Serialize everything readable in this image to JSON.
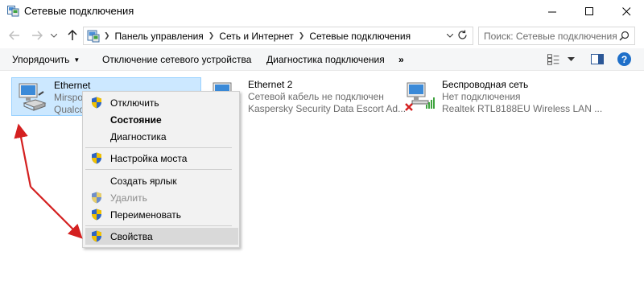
{
  "window": {
    "title": "Сетевые подключения",
    "controls": {
      "minimize": "—",
      "maximize": "☐",
      "close": "✕"
    }
  },
  "address": {
    "crumbs": [
      "Панель управления",
      "Сеть и Интернет",
      "Сетевые подключения"
    ],
    "search_placeholder": "Поиск: Сетевые подключения"
  },
  "toolbar": {
    "organize": "Упорядочить",
    "disable": "Отключение сетевого устройства",
    "diagnose": "Диагностика подключения",
    "more": "»",
    "help": "?"
  },
  "connections": [
    {
      "name": "Ethernet",
      "status": "Mirspo",
      "device": "Qualco",
      "selected": true,
      "icon": "network-adapter-icon"
    },
    {
      "name": "Ethernet 2",
      "status": "Сетевой кабель не подключен",
      "device": "Kaspersky Security Data Escort Ad...",
      "selected": false,
      "icon": "network-adapter-cable-unplugged-icon"
    },
    {
      "name": "Беспроводная сеть",
      "status": "Нет подключения",
      "device": "Realtek RTL8188EU Wireless LAN ...",
      "selected": false,
      "icon": "wireless-adapter-disconnected-icon"
    }
  ],
  "context_menu": {
    "items": [
      {
        "label": "Отключить",
        "shield": true,
        "bold": false,
        "disabled": false
      },
      {
        "label": "Состояние",
        "shield": false,
        "bold": true,
        "disabled": false
      },
      {
        "label": "Диагностика",
        "shield": false,
        "bold": false,
        "disabled": false
      },
      {
        "label": "Настройка моста",
        "shield": true,
        "bold": false,
        "disabled": false
      },
      {
        "label": "Создать ярлык",
        "shield": false,
        "bold": false,
        "disabled": false
      },
      {
        "label": "Удалить",
        "shield": true,
        "bold": false,
        "disabled": true
      },
      {
        "label": "Переименовать",
        "shield": true,
        "bold": false,
        "disabled": false
      },
      {
        "label": "Свойства",
        "shield": true,
        "bold": false,
        "disabled": false,
        "highlighted": true
      }
    ]
  },
  "colors": {
    "selection_bg": "#cce8ff",
    "selection_border": "#99d1ff",
    "annotation_arrow": "#d42020",
    "help_blue": "#1e6fc9"
  }
}
